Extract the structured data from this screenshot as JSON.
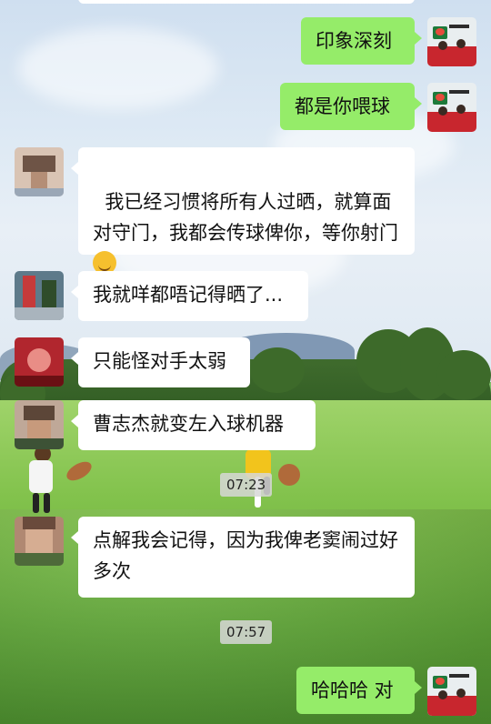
{
  "messages": [
    {
      "side": "out",
      "text": "印象深刻"
    },
    {
      "side": "out",
      "text": "都是你喂球"
    },
    {
      "side": "in",
      "text": "我已经习惯将所有人过晒，就算面对守门，我都会传球俾你，等你射门",
      "emoji": "face-with-tears-of-joy"
    },
    {
      "side": "in",
      "text": "我就咩都唔记得晒了..."
    },
    {
      "side": "in",
      "text": "只能怪对手太弱"
    },
    {
      "side": "in",
      "text": "曹志杰就变左入球机器"
    },
    {
      "side": "in",
      "text": "点解我会记得，因为我俾老窦闹过好多次"
    },
    {
      "side": "out",
      "text": "哈哈哈 对"
    }
  ],
  "timestamps": [
    "07:23",
    "07:57"
  ],
  "colors": {
    "outgoing_bubble": "#95ec69",
    "incoming_bubble": "#ffffff",
    "timestamp_bg": "#d7d7d7"
  }
}
